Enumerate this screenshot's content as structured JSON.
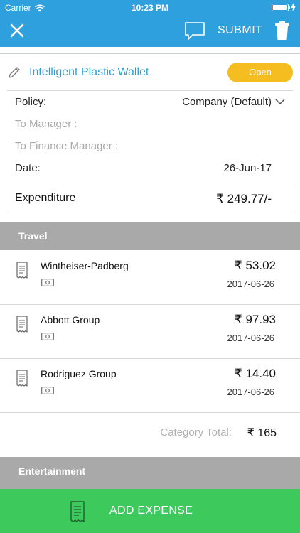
{
  "status_bar": {
    "carrier": "Carrier",
    "time": "10:23 PM"
  },
  "header": {
    "submit_label": "SUBMIT",
    "background_color": "#2ea0dd",
    "icons": [
      "close-icon",
      "chat-icon",
      "trash-icon"
    ]
  },
  "report": {
    "name": "Intelligent Plastic Wallet",
    "status": "Open",
    "status_color": "#f5bd1f",
    "policy_label": "Policy:",
    "policy_value": "Company (Default)",
    "to_manager_label": "To Manager :",
    "to_finance_manager_label": "To Finance Manager :",
    "date_label": "Date:",
    "date_value": "26-Jun-17",
    "expenditure_label": "Expenditure",
    "expenditure_value": "₹ 249.77/-"
  },
  "categories": [
    {
      "title": "Travel",
      "items": [
        {
          "merchant": "Wintheiser-Padberg",
          "amount": "₹ 53.02",
          "date": "2017-06-26"
        },
        {
          "merchant": "Abbott Group",
          "amount": "₹ 97.93",
          "date": "2017-06-26"
        },
        {
          "merchant": "Rodriguez Group",
          "amount": "₹ 14.40",
          "date": "2017-06-26"
        }
      ],
      "total_label": "Category Total:",
      "total_value": "₹ 165"
    },
    {
      "title": "Entertainment"
    }
  ],
  "footer": {
    "add_expense_label": "ADD EXPENSE",
    "background_color": "#3dc95c"
  }
}
